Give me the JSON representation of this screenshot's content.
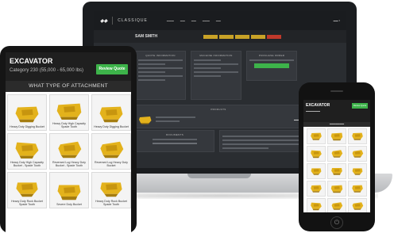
{
  "colors": {
    "accent_green": "#3db34a",
    "bucket_yellow": "#e3b21c",
    "dark_header": "#1f1f1f"
  },
  "laptop": {
    "brand": "CLASSIQUE",
    "customer_name": "SAM SMITH",
    "panels": [
      "QUOTE INFORMATION",
      "MACHINE INFORMATION",
      "PURCHASE ORDER"
    ],
    "products_header": "PRODUCTS",
    "documents_header": "DOCUMENTS"
  },
  "tablet": {
    "title": "EXCAVATOR",
    "category": "Category 230 (55,000 - 65,000 lbs)",
    "review_button": "Review Quote",
    "banner": "WHAT TYPE OF ATTACHMENT",
    "attachments": [
      {
        "label": "Heavy Duty Digging Bucket",
        "icon": "digging-bucket-icon"
      },
      {
        "label": "Heavy Duty High Capacity Spade Tooth",
        "icon": "high-capacity-bucket-icon"
      },
      {
        "label": "Heavy Duty Digging Bucket",
        "icon": "digging-bucket-icon"
      },
      {
        "label": "Heavy Duty High Capacity Bucket - Spade Tooth",
        "icon": "spade-tooth-bucket-icon"
      },
      {
        "label": "Reversed Lug Heavy Duty Bucket - Spade Tooth",
        "icon": "reversed-lug-bucket-icon"
      },
      {
        "label": "Reversed Lug Heavy Duty Bucket",
        "icon": "reversed-lug-bucket-icon"
      },
      {
        "label": "Heavy Duty Rock Bucket Spade Tooth",
        "icon": "rock-bucket-icon"
      },
      {
        "label": "Severe Duty Bucket",
        "icon": "severe-duty-bucket-icon"
      },
      {
        "label": "Heavy Duty Rock Bucket Spade Tooth",
        "icon": "rock-bucket-icon"
      }
    ]
  },
  "phone": {
    "title": "EXCAVATOR",
    "review_button": "Review Quote",
    "home_glyph": "⏻",
    "tile_count_note": ""
  }
}
